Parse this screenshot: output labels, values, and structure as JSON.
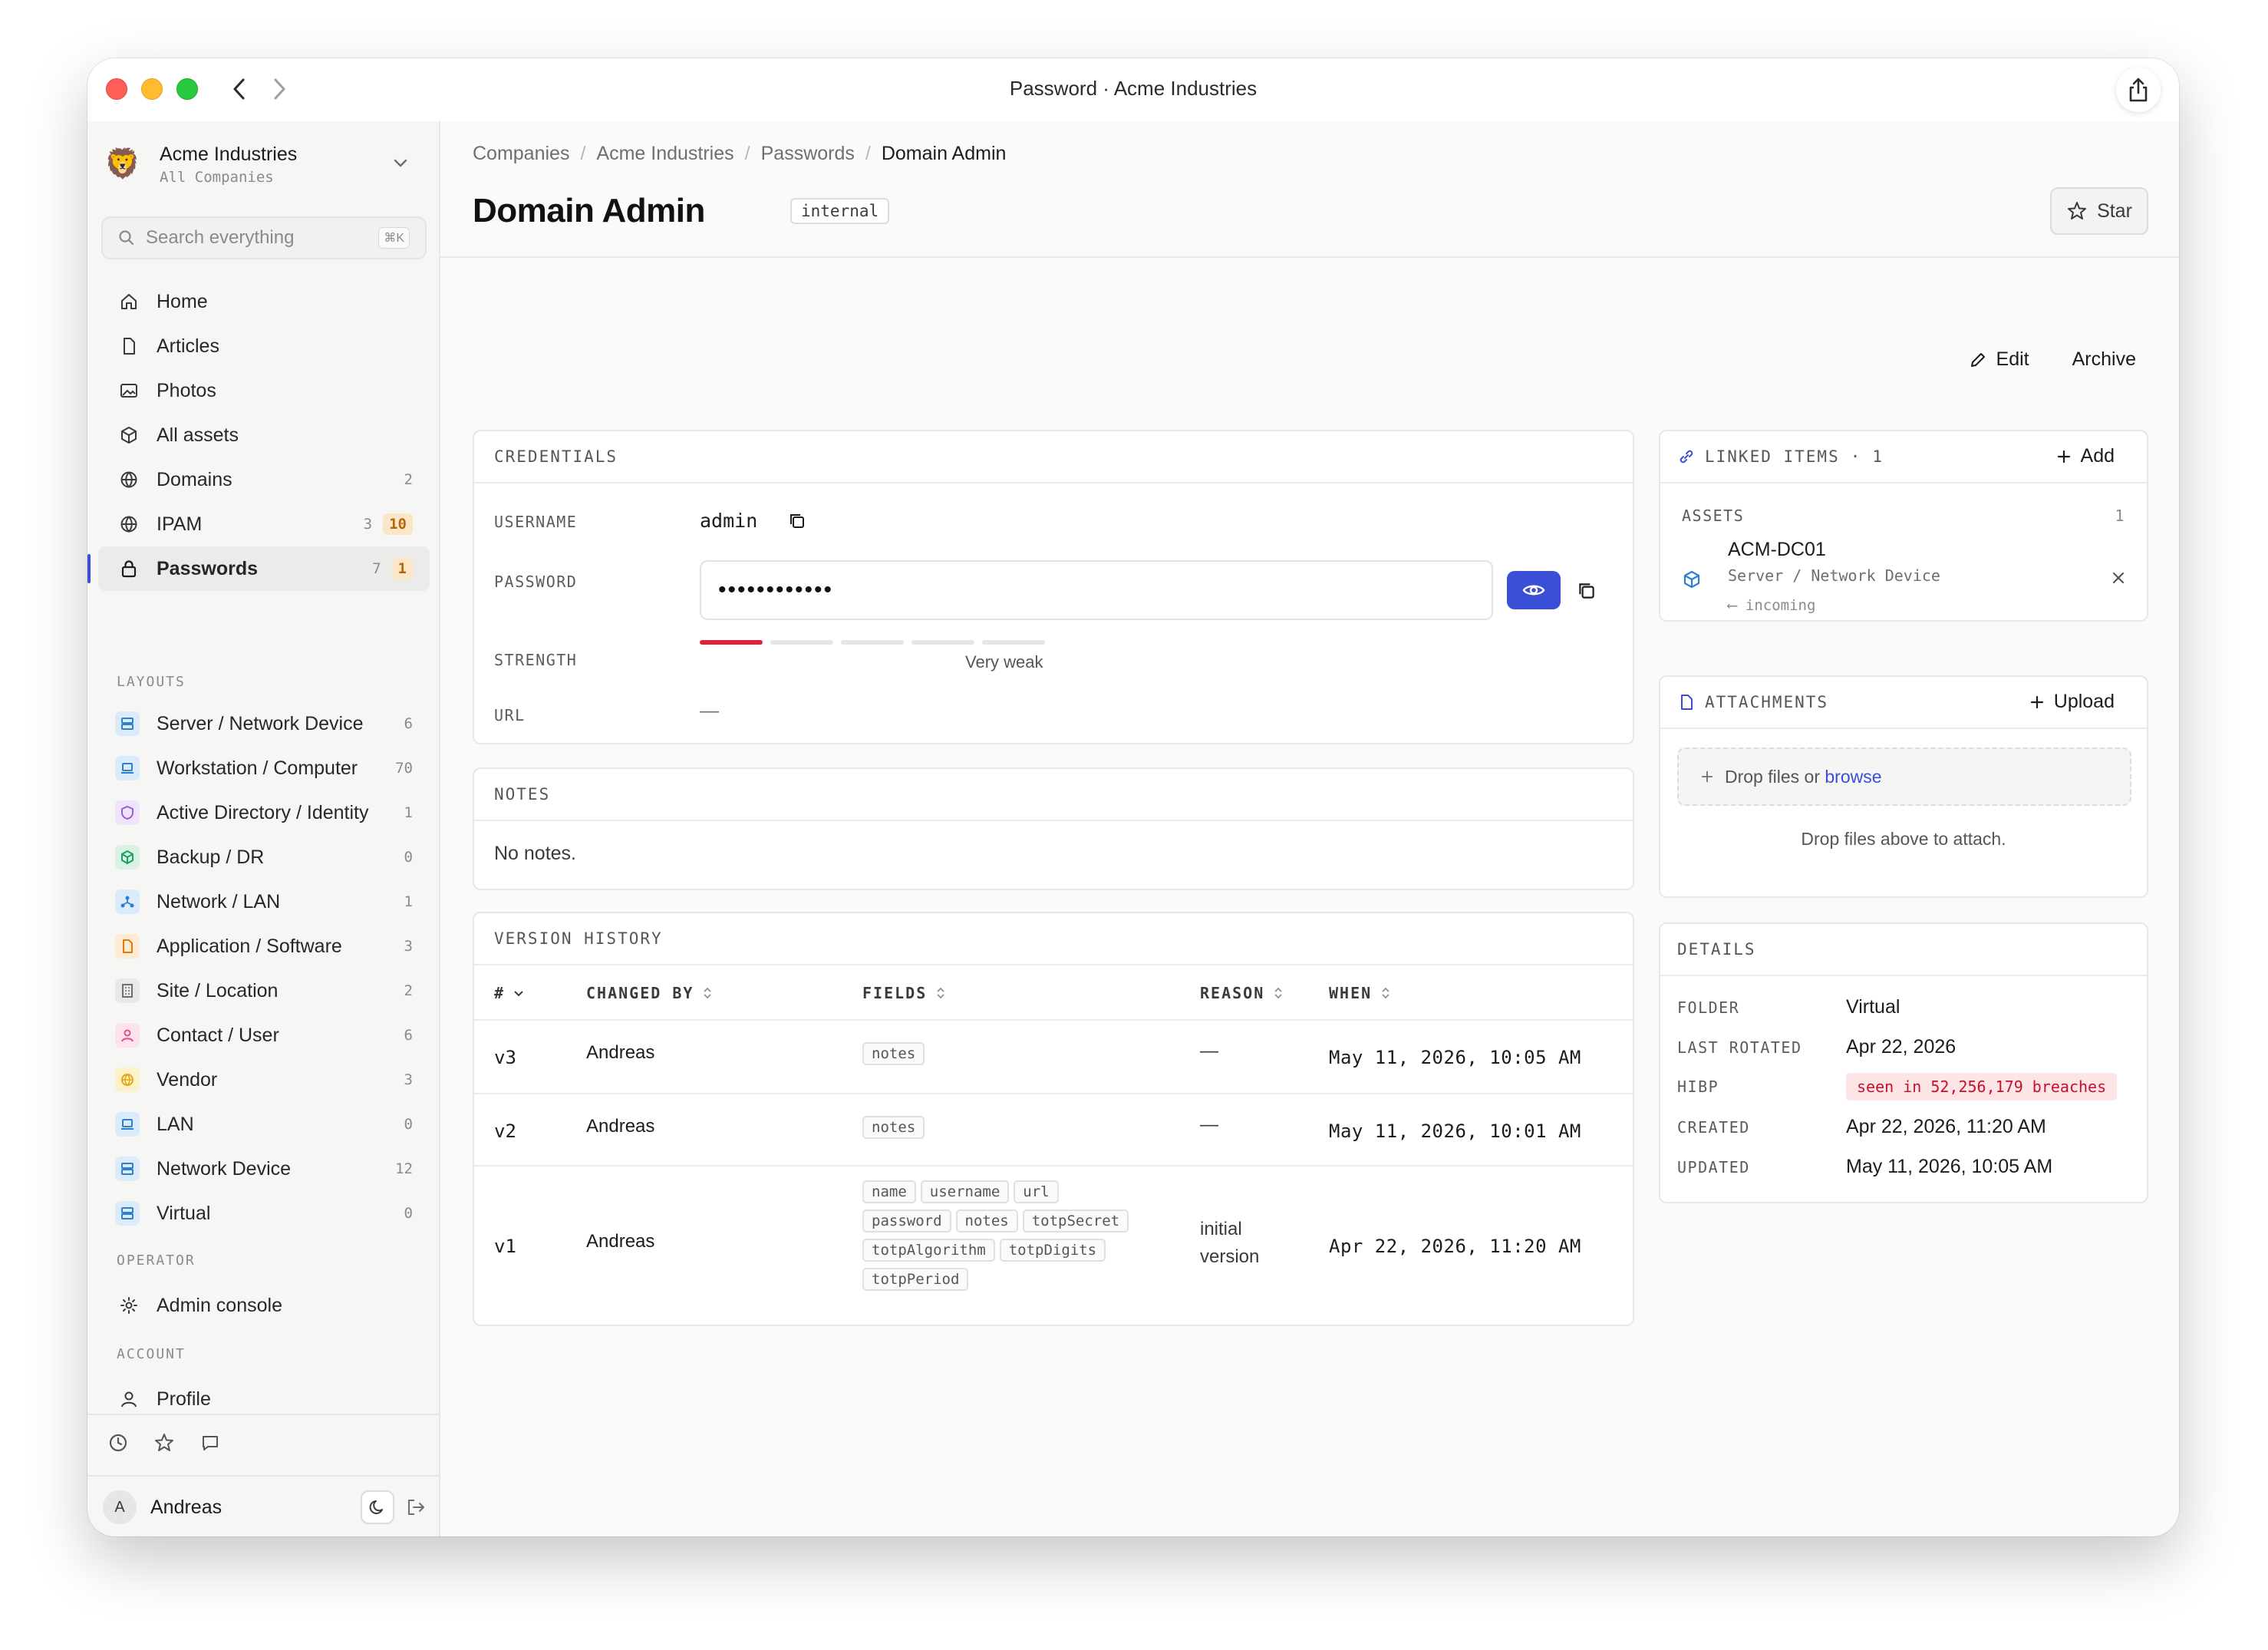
{
  "window": {
    "title": "Password · Acme Industries"
  },
  "org": {
    "name": "Acme Industries",
    "sub": "All Companies",
    "logo": "🦁"
  },
  "search": {
    "placeholder": "Search everything",
    "shortcut": "⌘K"
  },
  "nav": [
    {
      "label": "Home",
      "icon": "home-icon",
      "count": ""
    },
    {
      "label": "Articles",
      "icon": "document-icon",
      "count": ""
    },
    {
      "label": "Photos",
      "icon": "image-icon",
      "count": ""
    },
    {
      "label": "All assets",
      "icon": "cube-icon",
      "count": ""
    },
    {
      "label": "Domains",
      "icon": "globe-icon",
      "count": "2"
    },
    {
      "label": "IPAM",
      "icon": "globe-icon",
      "count": "3",
      "badge": "10"
    },
    {
      "label": "Passwords",
      "icon": "lock-icon",
      "count": "7",
      "badge": "1"
    }
  ],
  "sections": {
    "layouts": "LAYOUTS",
    "operator": "OPERATOR",
    "account": "ACCOUNT"
  },
  "layouts": [
    {
      "label": "Server / Network Device",
      "count": "6",
      "color": "#2f7fd0",
      "bg": "#dcebfa"
    },
    {
      "label": "Workstation / Computer",
      "count": "70",
      "color": "#2f7fd0",
      "bg": "#dcebfa"
    },
    {
      "label": "Active Directory / Identity",
      "count": "1",
      "color": "#9b5cdb",
      "bg": "#efe4fb"
    },
    {
      "label": "Backup / DR",
      "count": "0",
      "color": "#1e9e62",
      "bg": "#d9f2e5"
    },
    {
      "label": "Network / LAN",
      "count": "1",
      "color": "#2f7fd0",
      "bg": "#dcebfa"
    },
    {
      "label": "Application / Software",
      "count": "3",
      "color": "#e07b12",
      "bg": "#fdebd4"
    },
    {
      "label": "Site / Location",
      "count": "2",
      "color": "#6e6e73",
      "bg": "#e8e8e6"
    },
    {
      "label": "Contact / User",
      "count": "6",
      "color": "#e0508a",
      "bg": "#fce3ed"
    },
    {
      "label": "Vendor",
      "count": "3",
      "color": "#e5a810",
      "bg": "#fdf1c9"
    },
    {
      "label": "LAN",
      "count": "0",
      "color": "#2f7fd0",
      "bg": "#dcebfa"
    },
    {
      "label": "Network Device",
      "count": "12",
      "color": "#2f7fd0",
      "bg": "#dcebfa"
    },
    {
      "label": "Virtual",
      "count": "0",
      "color": "#2f7fd0",
      "bg": "#dcebfa"
    }
  ],
  "operator": {
    "admin_console": "Admin console"
  },
  "account": {
    "profile": "Profile"
  },
  "user": {
    "initial": "A",
    "name": "Andreas"
  },
  "breadcrumbs": [
    "Companies",
    "Acme Industries",
    "Passwords",
    "Domain Admin"
  ],
  "page": {
    "title": "Domain Admin",
    "tag": "internal",
    "star_label": "Star"
  },
  "actions": {
    "edit": "Edit",
    "archive": "Archive"
  },
  "credentials": {
    "heading": "CREDENTIALS",
    "username_label": "USERNAME",
    "username": "admin",
    "password_label": "PASSWORD",
    "password_masked": "••••••••••••",
    "strength_label": "STRENGTH",
    "strength_text": "Very weak",
    "strength_level": 1,
    "strength_total": 5,
    "url_label": "URL",
    "url": "—"
  },
  "notes": {
    "heading": "NOTES",
    "body": "No notes."
  },
  "version_history": {
    "heading": "VERSION HISTORY",
    "columns": [
      "#",
      "CHANGED BY",
      "FIELDS",
      "REASON",
      "WHEN"
    ],
    "rows": [
      {
        "version": "v3",
        "by": "Andreas",
        "fields": [
          "notes"
        ],
        "reason": "—",
        "when": "May 11, 2026, 10:05 AM"
      },
      {
        "version": "v2",
        "by": "Andreas",
        "fields": [
          "notes"
        ],
        "reason": "—",
        "when": "May 11, 2026, 10:01 AM"
      },
      {
        "version": "v1",
        "by": "Andreas",
        "fields": [
          "name",
          "username",
          "url",
          "password",
          "notes",
          "totpSecret",
          "totpAlgorithm",
          "totpDigits",
          "totpPeriod"
        ],
        "reason_line1": "initial",
        "reason_line2": "version",
        "when": "Apr 22, 2026, 11:20 AM"
      }
    ]
  },
  "linked": {
    "heading": "LINKED ITEMS",
    "count": "1",
    "add_label": "Add",
    "group_label": "ASSETS",
    "group_count": "1",
    "item_name": "ACM-DC01",
    "item_type": "Server / Network Device",
    "item_direction": "⟵ incoming"
  },
  "attachments": {
    "heading": "ATTACHMENTS",
    "upload_label": "Upload",
    "drop_text": "Drop files or",
    "browse_text": "browse",
    "empty_text": "Drop files above to attach."
  },
  "details": {
    "heading": "DETAILS",
    "folder_label": "FOLDER",
    "folder": "Virtual",
    "rotated_label": "LAST ROTATED",
    "rotated": "Apr 22, 2026",
    "hibp_label": "HIBP",
    "hibp": "seen in 52,256,179 breaches",
    "created_label": "CREATED",
    "created": "Apr 22, 2026, 11:20 AM",
    "updated_label": "UPDATED",
    "updated": "May 11, 2026, 10:05 AM"
  },
  "colors": {
    "accent": "#3b4fd6",
    "danger": "#d7263d"
  }
}
